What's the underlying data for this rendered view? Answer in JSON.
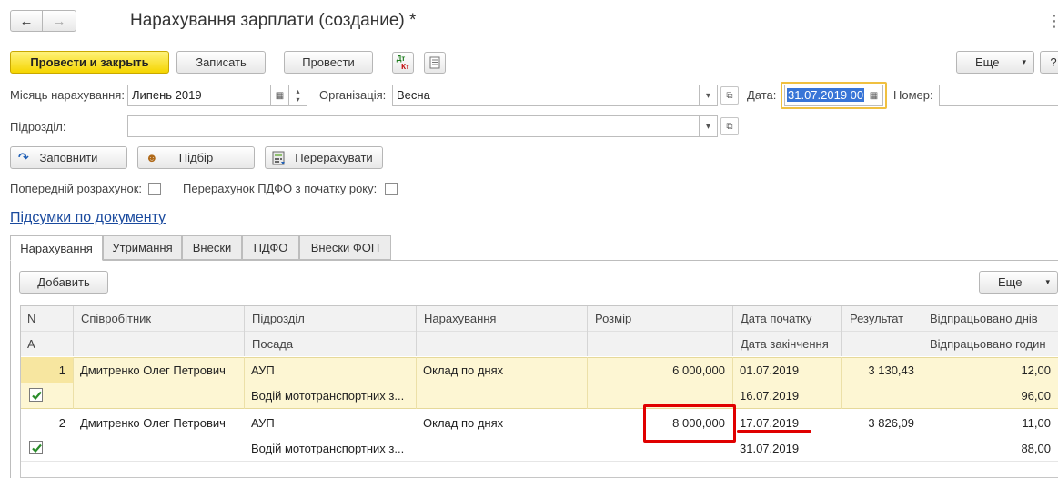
{
  "window": {
    "title": "Нарахування зарплати (создание) *",
    "back_glyph": "←",
    "forward_glyph": "→",
    "more_glyph": "⋮"
  },
  "toolbar": {
    "post_close": "Провести и закрыть",
    "save": "Записать",
    "post": "Провести",
    "dt_kt_top": "Дт",
    "dt_kt_bottom": "Кт",
    "more": "Еще",
    "help": "?"
  },
  "form": {
    "month_label": "Місяць нарахування:",
    "month_value": "Липень 2019",
    "org_label": "Організація:",
    "org_value": "Весна",
    "date_label": "Дата:",
    "date_value": "31.07.2019 00",
    "number_label": "Номер:",
    "number_value": "",
    "dept_label": "Підрозділ:",
    "dept_value": ""
  },
  "actions": {
    "fill": "Заповнити",
    "pick": "Підбір",
    "recalc": "Перерахувати"
  },
  "options": {
    "prelim_label": "Попередній розрахунок:",
    "prelim_checked": false,
    "pdfo_label": "Перерахунок ПДФО з початку року:",
    "pdfo_checked": false
  },
  "summary_link": "Підсумки по документу",
  "tabs": [
    "Нарахування",
    "Утримання",
    "Внески",
    "ПДФО",
    "Внески ФОП"
  ],
  "table_toolbar": {
    "add": "Добавить",
    "more": "Еще"
  },
  "table": {
    "headers_top": [
      "N",
      "Співробітник",
      "Підрозділ",
      "Нарахування",
      "Розмір",
      "Дата початку",
      "Результат",
      "Відпрацьовано днів"
    ],
    "headers_bottom": [
      "А",
      "",
      "Посада",
      "",
      "",
      "Дата закінчення",
      "",
      "Відпрацьовано годин"
    ],
    "rows": [
      {
        "n": "1",
        "employee": "Дмитренко Олег Петрович",
        "dept": "АУП",
        "position": "Водій мототранспортних з...",
        "accrual": "Оклад по днях",
        "amount": "6 000,000",
        "date_start": "01.07.2019",
        "date_end": "16.07.2019",
        "result": "3 130,43",
        "days": "12,00",
        "hours": "96,00",
        "active": true
      },
      {
        "n": "2",
        "employee": "Дмитренко Олег Петрович",
        "dept": "АУП",
        "position": "Водій мототранспортних з...",
        "accrual": "Оклад по днях",
        "amount": "8 000,000",
        "date_start": "17.07.2019",
        "date_end": "31.07.2019",
        "result": "3 826,09",
        "days": "11,00",
        "hours": "88,00",
        "active": true
      }
    ]
  },
  "colors": {
    "primary_button": "#f5d500",
    "selected_row": "#fdf6d3",
    "link": "#1a4a9e",
    "highlight_frame": "#e00000",
    "date_focus": "#f0c040",
    "checkmark": "#2a8c2a"
  }
}
